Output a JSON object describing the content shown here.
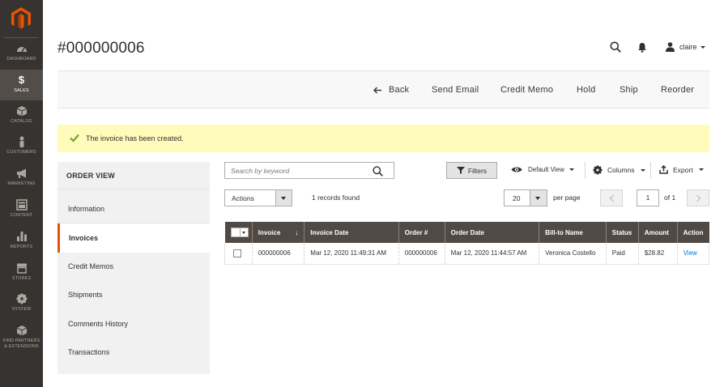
{
  "sidebar": {
    "items": [
      {
        "label": "Dashboard",
        "icon": "dashboard-icon"
      },
      {
        "label": "Sales",
        "icon": "dollar-icon",
        "active": true
      },
      {
        "label": "Catalog",
        "icon": "box-icon"
      },
      {
        "label": "Customers",
        "icon": "person-icon"
      },
      {
        "label": "Marketing",
        "icon": "megaphone-icon"
      },
      {
        "label": "Content",
        "icon": "layout-icon"
      },
      {
        "label": "Reports",
        "icon": "bar-chart-icon"
      },
      {
        "label": "Stores",
        "icon": "store-icon"
      },
      {
        "label": "System",
        "icon": "gear-icon"
      },
      {
        "label": "Find Partners & Extensions",
        "icon": "cube-icon"
      }
    ]
  },
  "header": {
    "title": "#000000006",
    "user": "claire"
  },
  "actionbar": {
    "back": "Back",
    "send_email": "Send Email",
    "credit_memo": "Credit Memo",
    "hold": "Hold",
    "ship": "Ship",
    "reorder": "Reorder"
  },
  "message": {
    "text": "The invoice has been created."
  },
  "order_view": {
    "title": "ORDER VIEW",
    "items": [
      {
        "label": "Information"
      },
      {
        "label": "Invoices",
        "active": true
      },
      {
        "label": "Credit Memos"
      },
      {
        "label": "Shipments"
      },
      {
        "label": "Comments History"
      },
      {
        "label": "Transactions"
      }
    ]
  },
  "grid_controls": {
    "search_placeholder": "Search by keyword",
    "filters": "Filters",
    "view": "Default View",
    "columns": "Columns",
    "export": "Export",
    "actions": "Actions",
    "records": "1 records found",
    "per_page_value": "20",
    "per_page_label": "per page",
    "current_page": "1",
    "of_pages": "of 1"
  },
  "table": {
    "columns": [
      "Invoice",
      "Invoice Date",
      "Order #",
      "Order Date",
      "Bill-to Name",
      "Status",
      "Amount",
      "Action"
    ],
    "sort_indicator": "↓",
    "rows": [
      {
        "invoice": "000000006",
        "invoice_date": "Mar 12, 2020 11:49:31 AM",
        "order": "000000006",
        "order_date": "Mar 12, 2020 11:44:57 AM",
        "bill_to": "Veronica Costello",
        "status": "Paid",
        "amount": "$28.82",
        "action": "View"
      }
    ]
  },
  "colors": {
    "sidebar_bg": "#373330",
    "accent": "#eb5202",
    "table_header": "#514943",
    "message_bg": "#fffbbb",
    "link": "#007bdb"
  }
}
